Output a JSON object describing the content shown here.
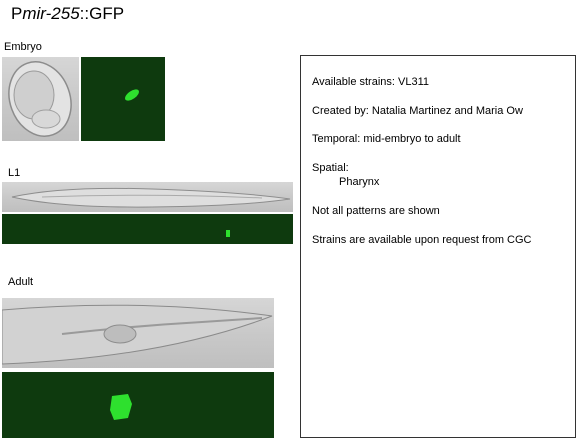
{
  "title": {
    "prefix": "P",
    "gene": "mir-255",
    "suffix": "::GFP"
  },
  "panels": [
    {
      "label": "Embryo"
    },
    {
      "label": "L1"
    },
    {
      "label": "Adult"
    }
  ],
  "info": {
    "available_strains": "Available strains: VL311",
    "created_by": "Created by: Natalia Martinez and Maria Ow",
    "temporal": "Temporal: mid-embryo to adult",
    "spatial_label": "Spatial:",
    "spatial_value": "Pharynx",
    "note": "Not all patterns are shown",
    "request": "Strains are available upon request from CGC"
  },
  "colors": {
    "gfp_background": "#0e3a0e",
    "gfp_signal": "#2ee02e",
    "dic_gray": "#c8c8c8"
  }
}
